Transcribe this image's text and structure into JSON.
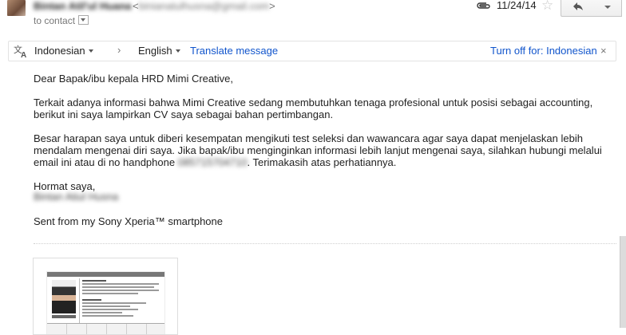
{
  "header": {
    "sender_name": "Bintan Atil'ul Huana",
    "sender_email_open": "<",
    "sender_email": "binianatulhusna@gmail.com",
    "sender_email_close": ">",
    "to_line": "to contact",
    "date": "11/24/14",
    "icons": {
      "attachment": "paperclip-icon",
      "star": "star-icon",
      "reply": "reply-arrow-icon",
      "more": "chevron-down-icon"
    }
  },
  "translate_bar": {
    "source_lang": "Indonesian",
    "arrow": "›",
    "target_lang": "English",
    "translate_link": "Translate message",
    "turn_off_link": "Turn off for: Indonesian",
    "close": "×"
  },
  "message": {
    "greeting": "Dear Bapak/ibu kepala HRD Mimi Creative,",
    "p1_line1": "Terkait adanya informasi bahwa Mimi Creative sedang membutuhkan tenaga profesional untuk posisi sebagai accounting,",
    "p1_line2": "berikut ini saya lampirkan CV saya sebagai bahan pertimbangan.",
    "p2_line1": "Besar harapan saya untuk diberi kesempatan mengikuti test seleksi dan wawancara agar saya dapat menjelaskan lebih",
    "p2_line2": "mendalam mengenai diri saya. Jika bapak/ibu menginginkan informasi lebih lanjut mengenai saya, silahkan hubungi melalui",
    "p2_line3_a": "email ini atau di no handphone",
    "phone": "085715704710",
    "p2_line3_b": ". Terimakasih atas perhatiannya.",
    "closing": "Hormat saya,",
    "signature": "Bintan Atiul Husna",
    "sent_from": "Sent from my Sony Xperia™ smartphone"
  },
  "colors": {
    "link": "#1155cc",
    "text": "#222222",
    "muted": "#777777"
  }
}
